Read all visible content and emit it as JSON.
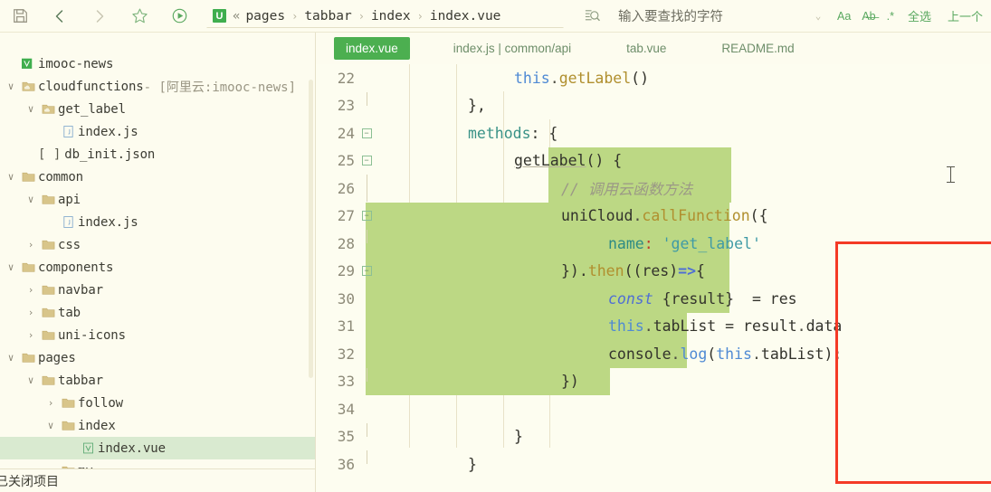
{
  "toolbar": {
    "icons": [
      {
        "name": "save-icon",
        "title": "save"
      },
      {
        "name": "back-arrow-icon",
        "title": "back"
      },
      {
        "name": "forward-arrow-icon",
        "title": "forward"
      },
      {
        "name": "star-icon",
        "title": "bookmark"
      },
      {
        "name": "run-icon",
        "title": "run"
      }
    ],
    "breadcrumb": {
      "badge": "U",
      "guillemet": "«",
      "items": [
        "pages",
        "tabbar",
        "index",
        "index.vue"
      ],
      "separator": "›"
    },
    "search": {
      "placeholder": "输入要查找的字符",
      "value": "",
      "dropdown_caret": "⌄",
      "options": [
        "Aa",
        "A̶b̶",
        ".*"
      ],
      "select_all_label": "全选",
      "previous_label": "上一个"
    }
  },
  "sidebar": {
    "tree": [
      {
        "indent": 0,
        "twisty": "",
        "icon": "vue-project-icon",
        "label": "imooc-news",
        "suffix": "",
        "selected": false
      },
      {
        "indent": 0,
        "twisty": "∨",
        "icon": "cloud-folder-icon",
        "label": "cloudfunctions",
        "suffix": " - [阿里云:imooc-news]",
        "selected": false
      },
      {
        "indent": 1,
        "twisty": "∨",
        "icon": "cloud-folder-icon",
        "label": "get_label",
        "suffix": "",
        "selected": false
      },
      {
        "indent": 2,
        "twisty": "",
        "icon": "js-file-icon",
        "label": "index.js",
        "suffix": "",
        "selected": false
      },
      {
        "indent": 1,
        "twisty": "",
        "icon": "json-file-icon",
        "label": "db_init.json",
        "suffix": "",
        "selected": false
      },
      {
        "indent": 0,
        "twisty": "∨",
        "icon": "folder-icon",
        "label": "common",
        "suffix": "",
        "selected": false
      },
      {
        "indent": 1,
        "twisty": "∨",
        "icon": "folder-icon",
        "label": "api",
        "suffix": "",
        "selected": false
      },
      {
        "indent": 2,
        "twisty": "",
        "icon": "js-file-icon",
        "label": "index.js",
        "suffix": "",
        "selected": false
      },
      {
        "indent": 1,
        "twisty": "›",
        "icon": "folder-icon",
        "label": "css",
        "suffix": "",
        "selected": false
      },
      {
        "indent": 0,
        "twisty": "∨",
        "icon": "folder-icon",
        "label": "components",
        "suffix": "",
        "selected": false
      },
      {
        "indent": 1,
        "twisty": "›",
        "icon": "folder-icon",
        "label": "navbar",
        "suffix": "",
        "selected": false
      },
      {
        "indent": 1,
        "twisty": "›",
        "icon": "folder-icon",
        "label": "tab",
        "suffix": "",
        "selected": false
      },
      {
        "indent": 1,
        "twisty": "›",
        "icon": "folder-icon",
        "label": "uni-icons",
        "suffix": "",
        "selected": false
      },
      {
        "indent": 0,
        "twisty": "∨",
        "icon": "folder-icon",
        "label": "pages",
        "suffix": "",
        "selected": false
      },
      {
        "indent": 1,
        "twisty": "∨",
        "icon": "folder-icon",
        "label": "tabbar",
        "suffix": "",
        "selected": false
      },
      {
        "indent": 2,
        "twisty": "›",
        "icon": "folder-icon",
        "label": "follow",
        "suffix": "",
        "selected": false
      },
      {
        "indent": 2,
        "twisty": "∨",
        "icon": "folder-icon",
        "label": "index",
        "suffix": "",
        "selected": false
      },
      {
        "indent": 3,
        "twisty": "",
        "icon": "vue-file-icon",
        "label": "index.vue",
        "suffix": "",
        "selected": true
      },
      {
        "indent": 2,
        "twisty": "›",
        "icon": "folder-icon",
        "label": "my",
        "suffix": "",
        "selected": false
      }
    ],
    "status_text": "已关闭项目"
  },
  "editor": {
    "tabs": [
      {
        "label": "index.vue",
        "active": true
      },
      {
        "label": "index.js | common/api",
        "active": false
      },
      {
        "label": "tab.vue",
        "active": false
      },
      {
        "label": "README.md",
        "active": false
      }
    ],
    "lines": [
      {
        "num": "22",
        "fold": "none",
        "guide": "none"
      },
      {
        "num": "23",
        "fold": "line-half-up",
        "guide": "none"
      },
      {
        "num": "24",
        "fold": "box",
        "guide": "none"
      },
      {
        "num": "25",
        "fold": "box",
        "guide": "none"
      },
      {
        "num": "26",
        "fold": "line",
        "guide": "none"
      },
      {
        "num": "27",
        "fold": "box",
        "guide": "none"
      },
      {
        "num": "28",
        "fold": "line-half-up",
        "guide": "none"
      },
      {
        "num": "29",
        "fold": "box",
        "guide": "none"
      },
      {
        "num": "30",
        "fold": "none",
        "guide": "none"
      },
      {
        "num": "31",
        "fold": "none",
        "guide": "none"
      },
      {
        "num": "32",
        "fold": "none",
        "guide": "none"
      },
      {
        "num": "33",
        "fold": "line-half-up",
        "guide": "none"
      },
      {
        "num": "34",
        "fold": "none",
        "guide": "none"
      },
      {
        "num": "35",
        "fold": "line-half-up",
        "guide": "none"
      },
      {
        "num": "36",
        "fold": "line-half-up",
        "guide": "none"
      }
    ],
    "code": {
      "l22": "this.getLabel()",
      "l23": "},",
      "l24": "methods: {",
      "l25": "getLabel() {",
      "l26": "// 调用云函数方法",
      "l27": "uniCloud.callFunction({",
      "l28_prop": "name:",
      "l28_str": "'get_label'",
      "l29": "}).then((res)=>{",
      "l30_kw": "const",
      "l30_rest": "{result}  = res",
      "l31": "this.tabList = result.data",
      "l32": "console.log(this.tabList);",
      "l33": "})",
      "l35": "}",
      "l36": "}"
    },
    "annotation_color": "#f43a26",
    "selection_color": "#bcd884"
  }
}
